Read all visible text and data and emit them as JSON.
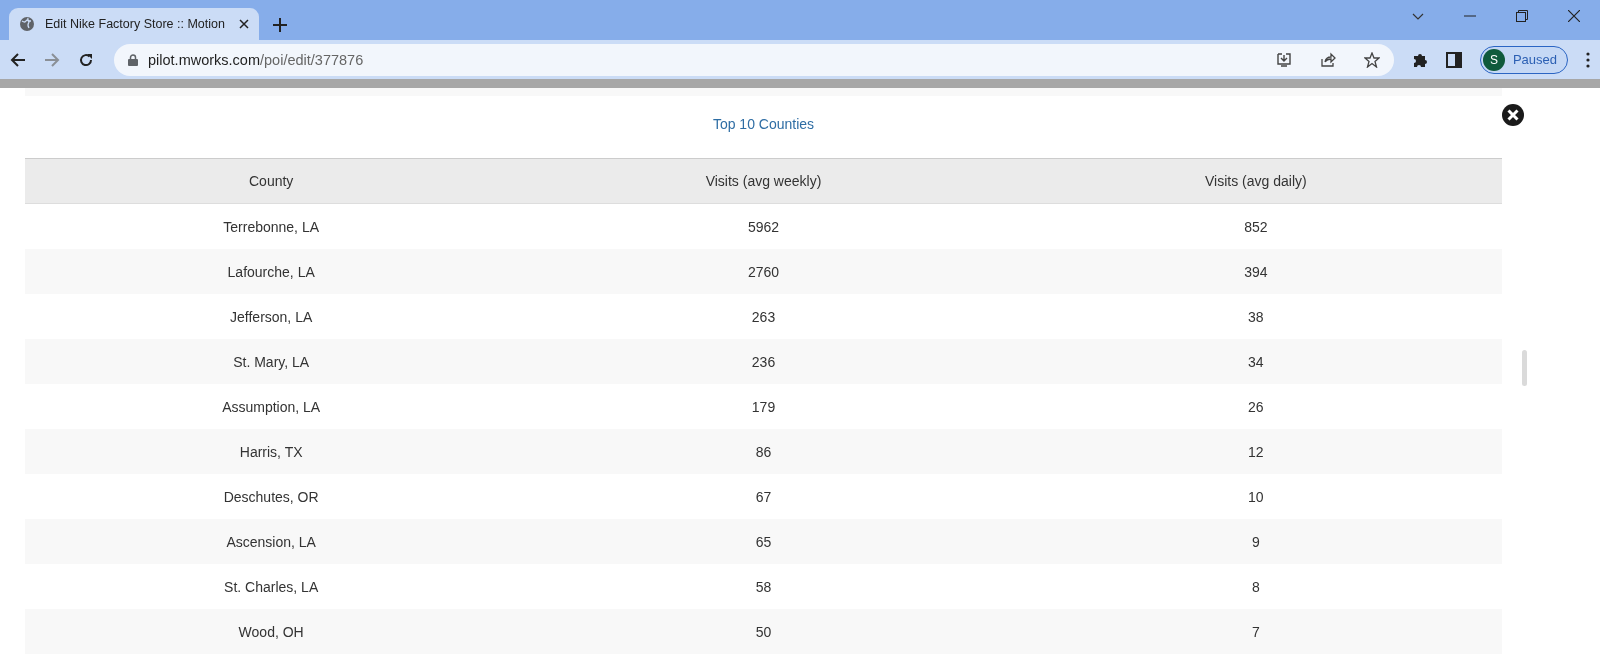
{
  "browser": {
    "tab_title": "Edit Nike Factory Store :: Motion",
    "url_host": "pilot.mworks.com",
    "url_path": "/poi/edit/377876",
    "profile_initial": "S",
    "profile_status": "Paused"
  },
  "table": {
    "title": "Top 10 Counties",
    "columns": [
      "County",
      "Visits (avg weekly)",
      "Visits (avg daily)"
    ],
    "rows": [
      [
        "Terrebonne, LA",
        "5962",
        "852"
      ],
      [
        "Lafourche, LA",
        "2760",
        "394"
      ],
      [
        "Jefferson, LA",
        "263",
        "38"
      ],
      [
        "St. Mary, LA",
        "236",
        "34"
      ],
      [
        "Assumption, LA",
        "179",
        "26"
      ],
      [
        "Harris, TX",
        "86",
        "12"
      ],
      [
        "Deschutes, OR",
        "67",
        "10"
      ],
      [
        "Ascension, LA",
        "65",
        "9"
      ],
      [
        "St. Charles, LA",
        "58",
        "8"
      ],
      [
        "Wood, OH",
        "50",
        "7"
      ]
    ]
  }
}
